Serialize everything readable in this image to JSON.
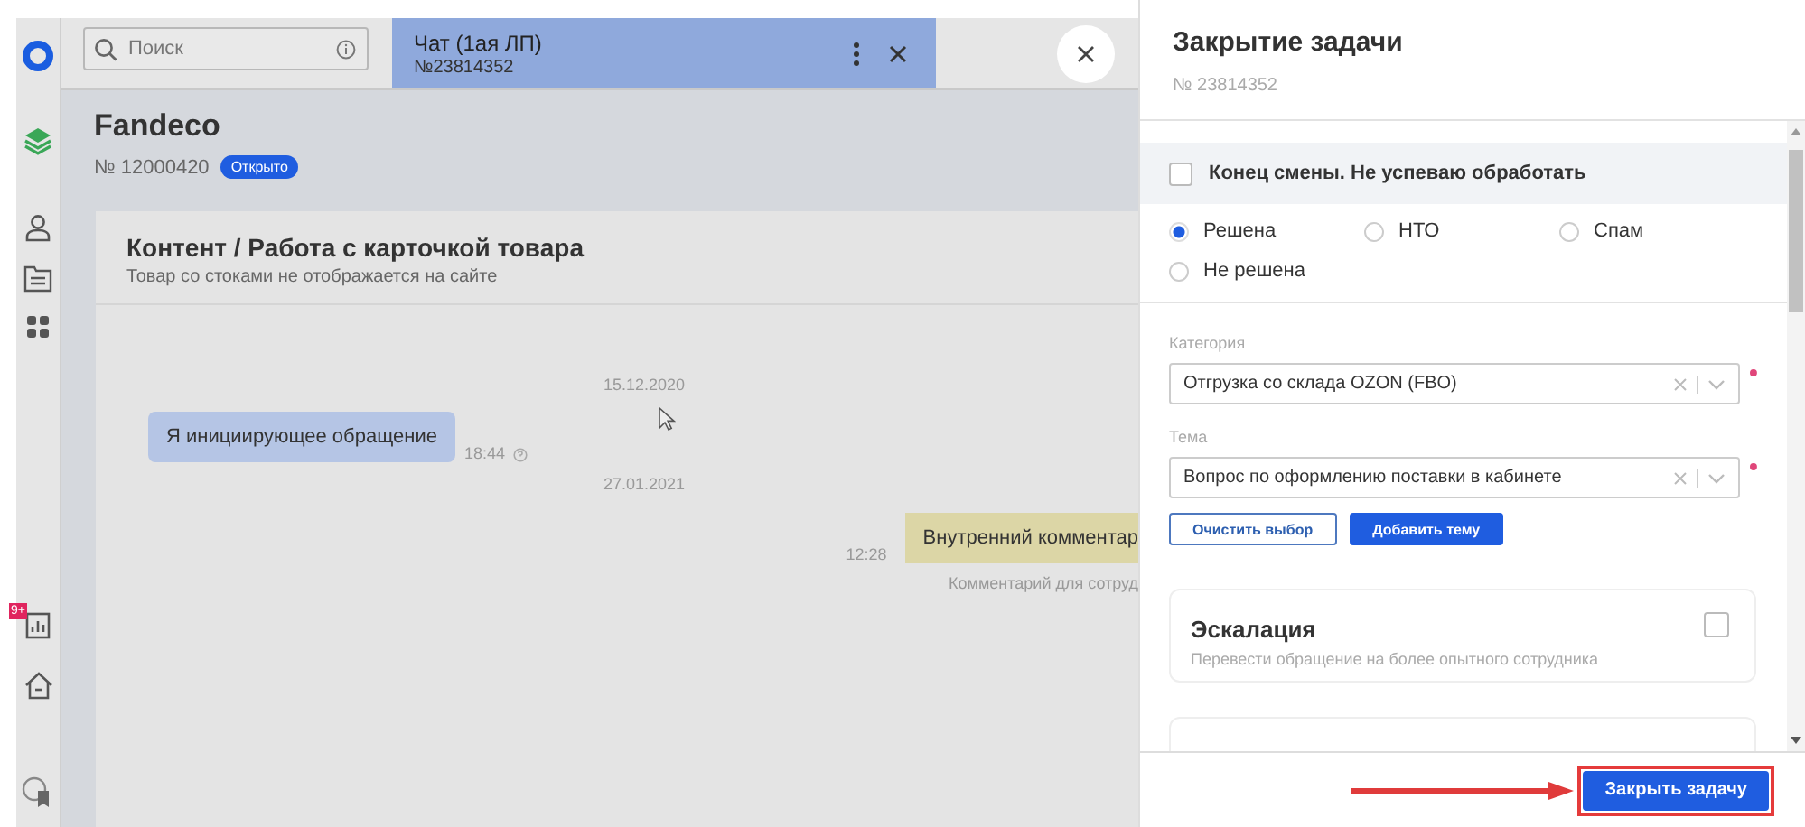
{
  "sidebar": {
    "badge": "9+"
  },
  "search": {
    "placeholder": "Поиск"
  },
  "chat_tab": {
    "title": "Чат (1ая ЛП)",
    "number": "№23814352",
    "selected": true
  },
  "ticket": {
    "title": "Fandeco",
    "number": "№ 12000420",
    "status": "Открыто"
  },
  "topic": {
    "title": "Контент / Работа с карточкой товара",
    "subtitle": "Товар со стоками не отображается на сайте"
  },
  "messages": [
    {
      "kind": "date",
      "text": "15.12.2020"
    },
    {
      "kind": "incoming",
      "text": "Я инициирующее обращение",
      "time": "18:44"
    },
    {
      "kind": "date",
      "text": "27.01.2021"
    },
    {
      "kind": "internal",
      "text": "Внутренний комментар",
      "time": "12:28",
      "note": "Комментарий для сотруд"
    }
  ],
  "dialog": {
    "title": "Закрытие задачи",
    "number": "№ 23814352",
    "end_shift": {
      "label": "Конец смены. Не успеваю обработать",
      "checked": false
    },
    "resolutions": [
      {
        "label": "Решена",
        "selected": true
      },
      {
        "label": "НТО",
        "selected": false
      },
      {
        "label": "Спам",
        "selected": false
      },
      {
        "label": "Не решена",
        "selected": false
      }
    ],
    "fields": [
      {
        "label": "Категория",
        "value": "Отгрузка со склада OZON (FBO)",
        "required": true
      },
      {
        "label": "Тема",
        "value": "Вопрос по оформлению поставки в кабинете",
        "required": true
      }
    ],
    "buttons": [
      {
        "label": "Очистить выбор",
        "kind": "outline"
      },
      {
        "label": "Добавить тему",
        "kind": "primary"
      }
    ],
    "escalation": {
      "title": "Эскалация",
      "description": "Перевести обращение на более опытного сотрудника",
      "checked": false
    },
    "submit": "Закрыть задачу"
  }
}
